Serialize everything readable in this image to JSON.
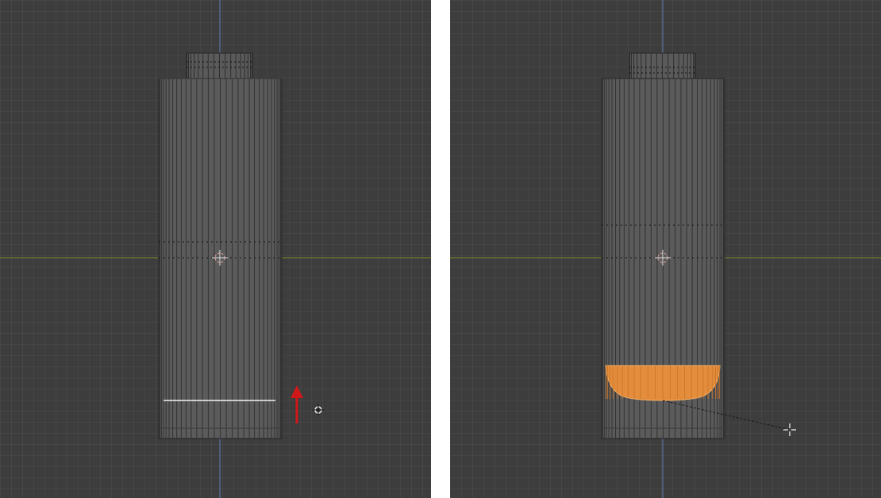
{
  "colors": {
    "viewport_bg": "#3d3d3d",
    "x_axis": "#7c8a2c",
    "z_axis": "#5a7fb6",
    "mesh_fill": "#5b5b5b",
    "mesh_edge": "#2e2e2e",
    "selected_face": "#f0913a",
    "selected_edge": "#ffffff",
    "annotation_arrow": "#d01818"
  },
  "icons": {
    "origin": "object-origin-icon",
    "cursor3d": "3d-cursor-icon",
    "move_arrow": "up-arrow-icon",
    "transform_cursor": "crosshair-cursor-icon"
  },
  "panels": [
    {
      "name": "left-viewport",
      "state": "edge-loop-selected"
    },
    {
      "name": "right-viewport",
      "state": "bottom-faces-scaled"
    }
  ]
}
